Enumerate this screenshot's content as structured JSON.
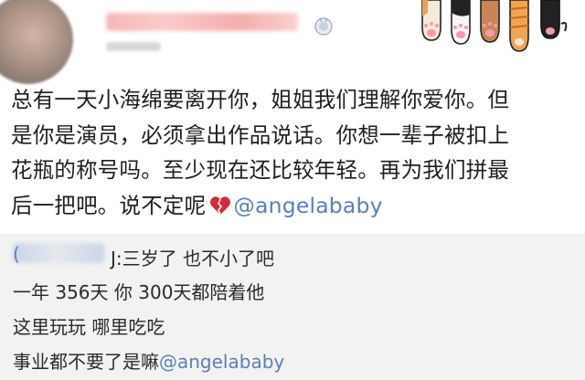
{
  "post": {
    "author_initial": "",
    "lines": [
      "总有一天小海绵要离开你，姐姐我们理解你爱你。但",
      "是你是演员，必须拿出作品说话。你想一辈子被扣上",
      "花瓶的称号吗。至少现在还比较年轻。再为我们拼最",
      "后一把吧。说不定呢"
    ],
    "mention": "@angelababy",
    "heart_icon": "broken-heart-icon"
  },
  "comment": {
    "commenter_initial": "(",
    "first_line": "J:三岁了 也不小了吧",
    "lines": [
      "一年 356天 你 300天都陪着他",
      "这里玩玩 哪里吃吃",
      "事业都不要了是嘛"
    ],
    "mention": "@angelababy"
  },
  "colors": {
    "link": "#5b7fb8",
    "comment_bg": "#f2f2f2",
    "heart": "#d8283a"
  }
}
